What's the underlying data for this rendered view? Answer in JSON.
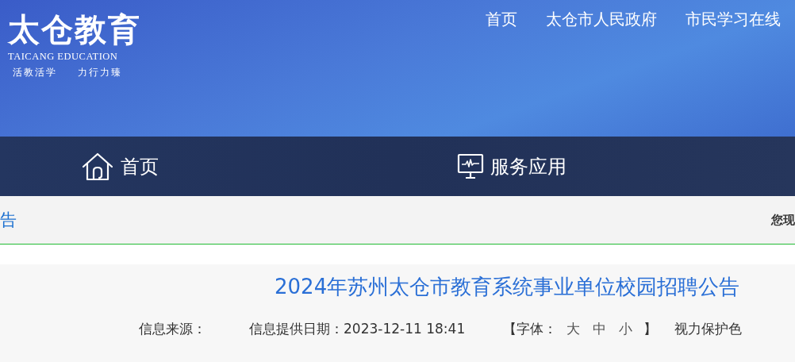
{
  "logo": {
    "title": "太仓教育",
    "subtitle": "TAICANG EDUCATION",
    "motto": [
      "活教活学",
      "力行力臻"
    ]
  },
  "top_links": [
    "首页",
    "太仓市人民政府",
    "市民学习在线"
  ],
  "nav": [
    {
      "label": "首页",
      "kind": "home"
    },
    {
      "label": "服务应用",
      "kind": "monitor"
    }
  ],
  "breadcrumb": {
    "current": "告",
    "location_label": "您现"
  },
  "article": {
    "title": "2024年苏州太仓市教育系统事业单位校园招聘公告",
    "source_label": "信息来源：",
    "date_label": "信息提供日期：",
    "date": "2023-12-11 18:41",
    "font_open": "【字体：",
    "font_sizes": [
      "大",
      "中",
      "小"
    ],
    "font_close": "】",
    "eye_care": "视力保护色"
  }
}
